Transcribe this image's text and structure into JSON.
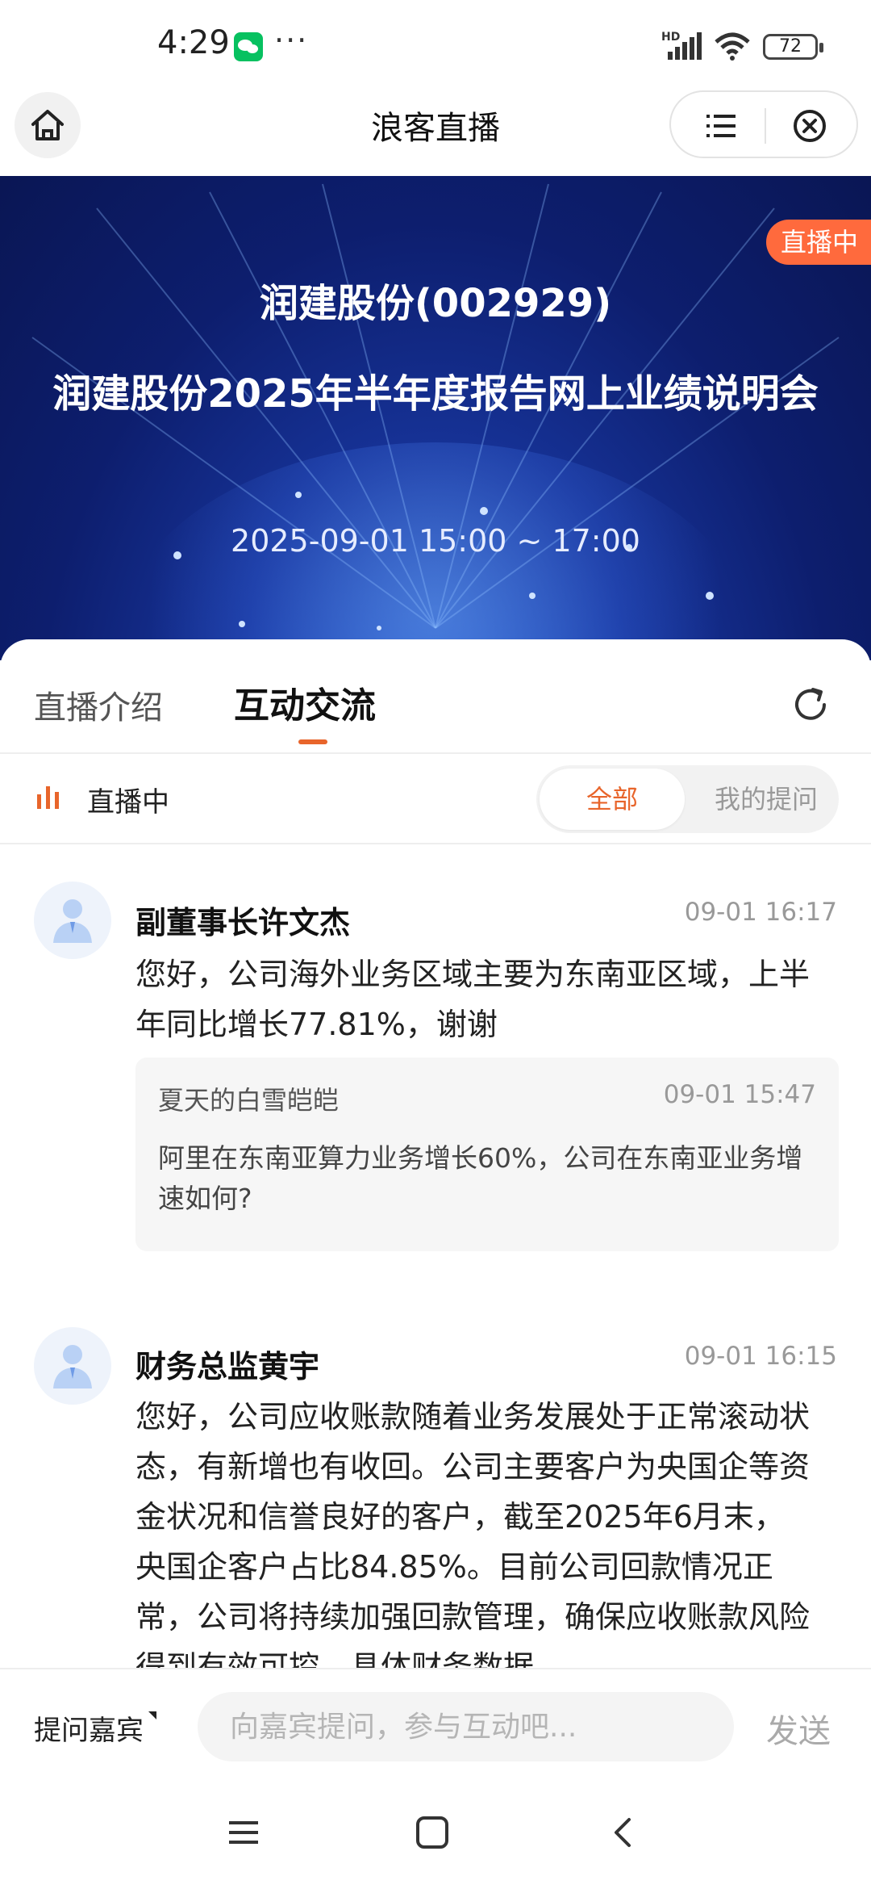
{
  "status_bar": {
    "time": "4:29",
    "more": "···",
    "network": "HD",
    "battery": "72"
  },
  "header": {
    "title": "浪客直播"
  },
  "banner": {
    "company": "润建股份(002929)",
    "title": "润建股份2025年半年度报告网上业绩说明会",
    "datetime": "2025-09-01 15:00 ~ 17:00",
    "live_badge": "直播中"
  },
  "tabs": [
    {
      "label": "直播介绍"
    },
    {
      "label": "互动交流"
    }
  ],
  "live_row": {
    "status": "直播中",
    "filters": {
      "all": "全部",
      "mine": "我的提问"
    }
  },
  "messages": [
    {
      "name": "副董事长许文杰",
      "time": "09-01 16:17",
      "content": "您好，公司海外业务区域主要为东南亚区域，上半年同比增长77.81%，谢谢",
      "quote": {
        "user": "夏天的白雪皑皑",
        "time": "09-01 15:47",
        "text": "阿里在东南亚算力业务增长60%，公司在东南亚业务增速如何?"
      }
    },
    {
      "name": "财务总监黄宇",
      "time": "09-01 16:15",
      "content": "您好，公司应收账款随着业务发展处于正常滚动状态，有新增也有收回。公司主要客户为央国企等资金状况和信誉良好的客户，截至2025年6月末， 央国企客户占比84.85%。目前公司回款情况正常，公司将持续加强回款管理，确保应收账款风险得到有效可控，具体财务数据"
    }
  ],
  "input_bar": {
    "ask_guest": "提问嘉宾",
    "placeholder": "向嘉宾提问，参与互动吧...",
    "send": "发送"
  },
  "colors": {
    "accent": "#e8652b",
    "live_badge": "#ff6a3d",
    "banner_bg": "#0d1e6e"
  }
}
